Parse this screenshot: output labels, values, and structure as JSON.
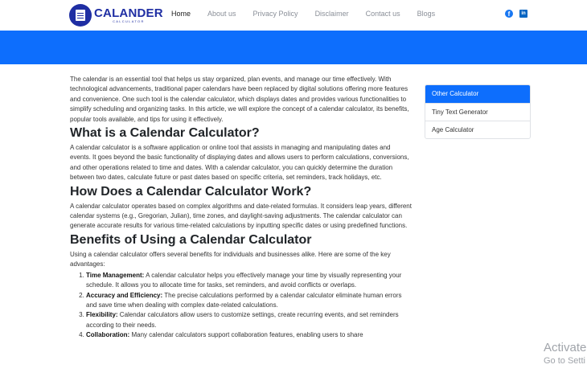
{
  "header": {
    "logo_main": "CALANDER",
    "logo_sub": "CALCULATOR",
    "nav": [
      "Home",
      "About us",
      "Privacy Policy",
      "Disclaimer",
      "Contact us",
      "Blogs"
    ],
    "social": {
      "facebook": "f",
      "linkedin": "in"
    }
  },
  "colors": {
    "brand": "#1f2ea3",
    "banner": "#0d6efd",
    "active": "#0d6efd"
  },
  "icons": [
    "calendar-logo-icon",
    "facebook-icon",
    "linkedin-icon"
  ],
  "article": {
    "intro": "The calendar is an essential tool that helps us stay organized, plan events, and manage our time effectively. With technological advancements, traditional paper calendars have been replaced by digital solutions offering more features and convenience. One such tool is the calendar calculator, which displays dates and provides various functionalities to simplify scheduling and organizing tasks. In this article, we will explore the concept of a calendar calculator, its benefits, popular tools available, and tips for using it effectively.",
    "h1": "What is a Calendar Calculator?",
    "p1": "A calendar calculator is a software application or online tool that assists in managing and manipulating dates and events. It goes beyond the basic functionality of displaying dates and allows users to perform calculations, conversions, and other operations related to time and dates. With a calendar calculator, you can quickly determine the duration between two dates, calculate future or past dates based on specific criteria, set reminders, track holidays, etc.",
    "h2": "How Does a Calendar Calculator Work?",
    "p2": "A calendar calculator operates based on complex algorithms and date-related formulas. It considers leap years, different calendar systems (e.g., Gregorian, Julian), time zones, and daylight-saving adjustments. The calendar calculator can generate accurate results for various time-related calculations by inputting specific dates or using predefined functions.",
    "h3": "Benefits of Using a Calendar Calculator",
    "p3": "Using a calendar calculator offers several benefits for individuals and businesses alike. Here are some of the key advantages:",
    "benefits": [
      {
        "title": "Time Management:",
        "text": "A calendar calculator helps you effectively manage your time by visually representing your schedule. It allows you to allocate time for tasks, set reminders, and avoid conflicts or overlaps."
      },
      {
        "title": "Accuracy and Efficiency:",
        "text": "The precise calculations performed by a calendar calculator eliminate human errors and save time when dealing with complex date-related calculations."
      },
      {
        "title": "Flexibility:",
        "text": "Calendar calculators allow users to customize settings, create recurring events, and set reminders according to their needs."
      },
      {
        "title": "Collaboration:",
        "text": "Many calendar calculators support collaboration features, enabling users to share"
      }
    ]
  },
  "sidebar": {
    "items": [
      "Other Calculator",
      "Tiny Text Generator",
      "Age Calculator"
    ]
  },
  "watermark": {
    "line1": "Activate",
    "line2": "Go to Setti"
  }
}
